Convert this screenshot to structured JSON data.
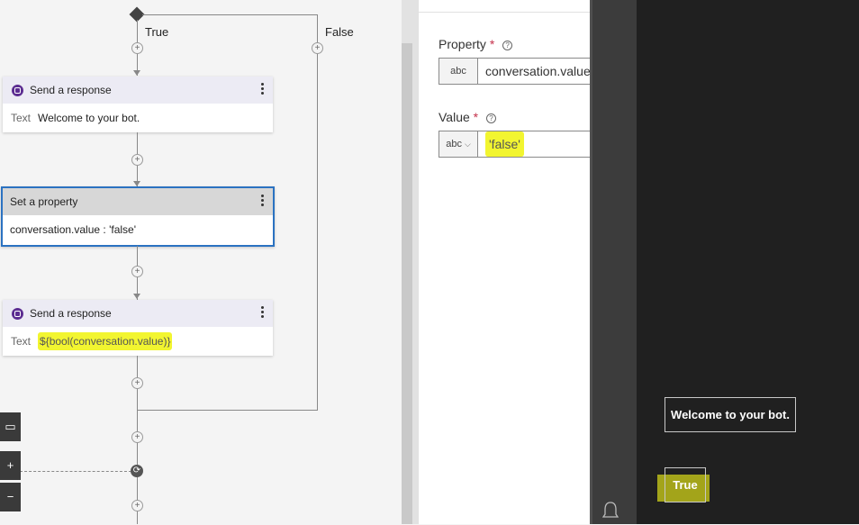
{
  "canvas": {
    "branches": {
      "true_label": "True",
      "false_label": "False"
    },
    "cards": [
      {
        "title": "Send a response",
        "body_label": "Text",
        "body_value": "Welcome to your bot."
      },
      {
        "title": "Set a property",
        "body_label": "",
        "body_value": "conversation.value : 'false'"
      },
      {
        "title": "Send a response",
        "body_label": "Text",
        "body_value": "${bool(conversation.value)}"
      }
    ],
    "tools": {
      "zoom_in": "+",
      "zoom_out": "−"
    }
  },
  "properties": {
    "property": {
      "label": "Property",
      "required_mark": "*",
      "type": "abc",
      "value": "conversation.value"
    },
    "value": {
      "label": "Value",
      "required_mark": "*",
      "type": "abc",
      "value": "'false'"
    }
  },
  "emulator": {
    "messages": [
      "Welcome to your bot.",
      "True"
    ]
  },
  "colors": {
    "accent_selected": "#2b72c1",
    "highlight": "#f2f530",
    "bot_icon": "#5c2d91"
  }
}
